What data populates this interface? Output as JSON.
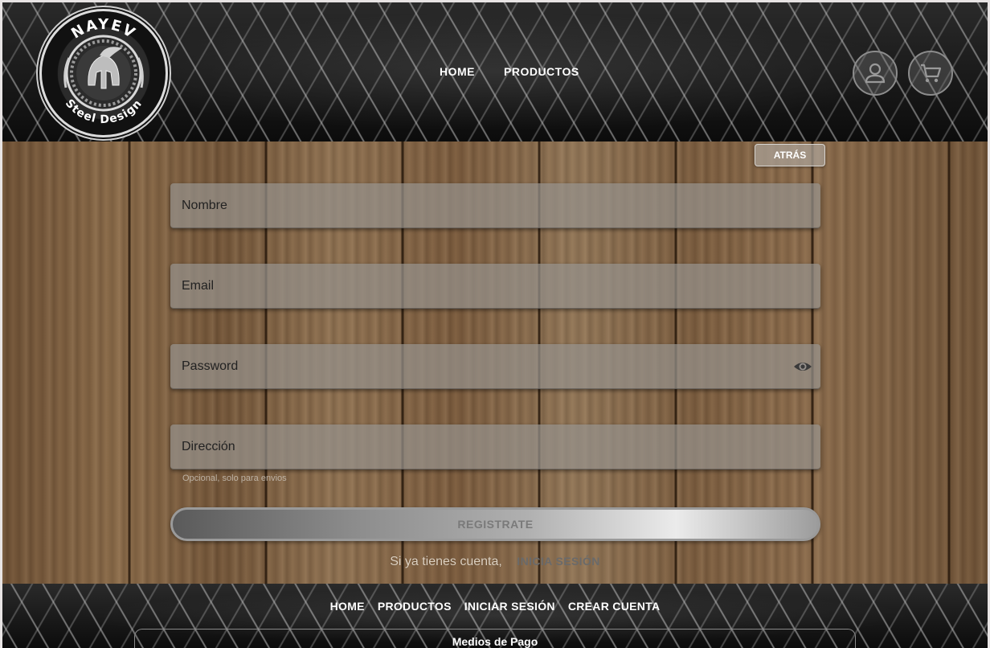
{
  "brand": {
    "top_text": "NAYEV",
    "bottom_text": "Steel Design"
  },
  "nav_top": {
    "home": "HOME",
    "products": "PRODUCTOS"
  },
  "icons": {
    "user": "user-icon",
    "cart": "cart-icon",
    "eye": "eye-icon"
  },
  "form": {
    "back_label": "ATRÁS",
    "name_placeholder": "Nombre",
    "email_placeholder": "Email",
    "password_placeholder": "Password",
    "address_placeholder": "Dirección",
    "address_hint": "Opcional, solo para envios",
    "register_label": "REGISTRATE",
    "have_account_text": "Si ya tienes cuenta,",
    "login_link": "INICIA SESIÓN"
  },
  "footer": {
    "home": "HOME",
    "products": "PRODUCTOS",
    "login": "INICIAR SESIÓN",
    "create_account": "CREAR CUENTA",
    "payment_title": "Medios de Pago"
  },
  "colors": {
    "accent_text": "#ffffff",
    "field_bg": "#96918c",
    "button_silver": "#b0b0b0"
  }
}
